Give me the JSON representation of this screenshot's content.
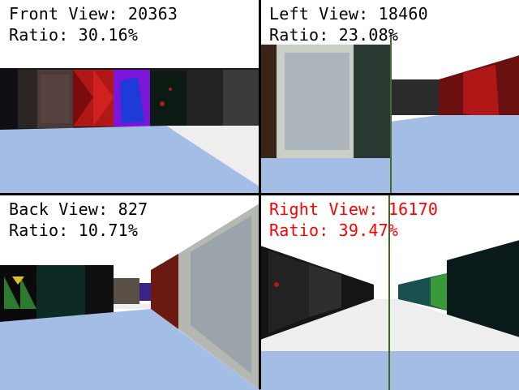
{
  "views": {
    "front": {
      "title": "Front View: 20363",
      "ratio": "Ratio: 30.16%",
      "text_color": "#000000"
    },
    "left": {
      "title": "Left View: 18460",
      "ratio": "Ratio: 23.08%",
      "text_color": "#000000"
    },
    "back": {
      "title": "Back View: 827",
      "ratio": "Ratio: 10.71%",
      "text_color": "#000000"
    },
    "right": {
      "title": "Right View: 16170",
      "ratio": "Ratio: 39.47%",
      "text_color": "#ff0000"
    }
  },
  "colors": {
    "floor": "#a4bde4",
    "ceiling": "#ffffff",
    "divider": "#000000"
  }
}
